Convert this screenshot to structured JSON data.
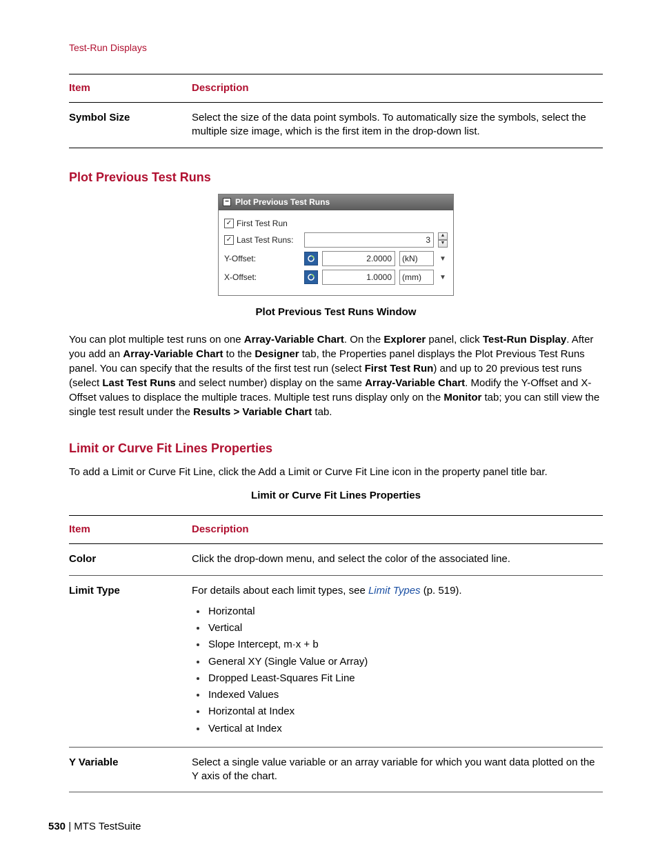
{
  "header": "Test-Run Displays",
  "table1": {
    "header_item": "Item",
    "header_desc": "Description",
    "row1_item": "Symbol Size",
    "row1_desc": "Select the size of the data point symbols. To automatically size the symbols, select the multiple size image, which is the first item in the drop-down list."
  },
  "section1": {
    "title": "Plot Previous Test Runs",
    "panel": {
      "title": "Plot Previous Test Runs",
      "first_test_run_label": "First Test Run",
      "last_test_runs_label": "Last Test Runs:",
      "last_test_runs_value": "3",
      "y_offset_label": "Y-Offset:",
      "y_offset_value": "2.0000",
      "y_offset_unit": "(kN)",
      "x_offset_label": "X-Offset:",
      "x_offset_value": "1.0000",
      "x_offset_unit": "(mm)"
    },
    "caption": "Plot Previous Test Runs Window",
    "body_parts": {
      "t0": "You can plot multiple test runs on one ",
      "b0": "Array-Variable Chart",
      "t1": ". On the ",
      "b1": "Explorer",
      "t2": " panel, click ",
      "b2": "Test-Run Display",
      "t3": ". After you add an ",
      "b3": "Array-Variable Chart",
      "t4": " to the ",
      "b4": "Designer",
      "t5": " tab, the Properties panel displays the Plot Previous Test Runs panel. You can specify that the results of the first test run (select ",
      "b5": "First Test Run",
      "t6": ") and up to 20 previous test runs (select ",
      "b6": "Last Test Runs",
      "t7": " and select number) display on the same ",
      "b7": "Array-Variable Chart",
      "t8": ". Modify the Y-Offset and X-Offset values to displace the multiple traces. Multiple test runs display only on the ",
      "b8": "Monitor",
      "t9": " tab; you can still view the single test result under the ",
      "b9": "Results > Variable Chart",
      "t10": " tab."
    }
  },
  "section2": {
    "title": "Limit or Curve Fit Lines Properties",
    "intro": "To add a Limit or Curve Fit Line, click the Add a Limit or Curve Fit Line icon in the property panel title bar.",
    "table_caption": "Limit or Curve Fit Lines Properties",
    "table": {
      "header_item": "Item",
      "header_desc": "Description",
      "color_item": "Color",
      "color_desc": "Click the drop-down menu, and select the color of the associated line.",
      "limit_item": "Limit Type",
      "limit_pre": "For details about each limit types, see ",
      "limit_link": "Limit Types",
      "limit_post": " (p. 519).",
      "bullets": [
        "Horizontal",
        "Vertical",
        "Slope Intercept, m·x + b",
        "General XY (Single Value or Array)",
        "Dropped Least-Squares Fit Line",
        "Indexed Values",
        "Horizontal at Index",
        "Vertical at Index"
      ],
      "yvar_item": "Y Variable",
      "yvar_desc": "Select a single value variable or an array variable for which you want data plotted on the Y axis of the chart."
    }
  },
  "footer": {
    "page": "530",
    "sep": " | ",
    "product": "MTS TestSuite"
  }
}
